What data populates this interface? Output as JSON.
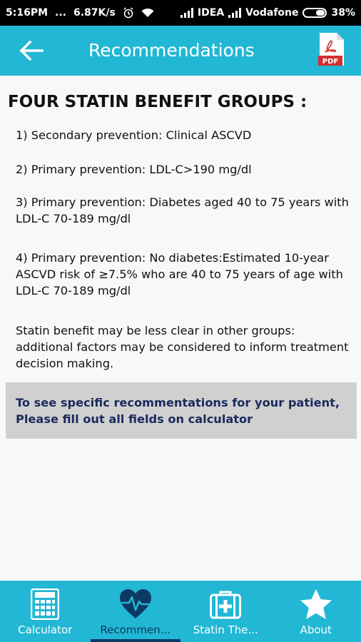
{
  "status_bar": {
    "time": "5:16PM",
    "dots": "...",
    "speed": "6.87K/s",
    "carrier1": "IDEA",
    "carrier2": "Vodafone",
    "battery": "38%"
  },
  "app_bar": {
    "title": "Recommendations",
    "pdf_label": "PDF"
  },
  "content": {
    "heading": "FOUR STATIN BENEFIT GROUPS :",
    "items": [
      "1) Secondary prevention: Clinical ASCVD",
      "2) Primary prevention: LDL-C>190 mg/dl",
      "3) Primary prevention: Diabetes aged 40 to 75 years with LDL-C 70-189 mg/dl",
      "4) Primary prevention: No diabetes:Estimated 10-year ASCVD risk of ≥7.5% who are 40 to 75 years of age with LDL-C 70-189 mg/dl"
    ],
    "note": "Statin benefit may be less clear in other groups: additional factors may be considered to inform treatment decision making.",
    "notice": "To see specific recommentations for your patient, Please fill out all fields on calculator"
  },
  "bottom_nav": {
    "items": [
      {
        "label": "Calculator",
        "icon": "calculator-icon"
      },
      {
        "label": "Recommen...",
        "icon": "heart-pulse-icon"
      },
      {
        "label": "Statin The...",
        "icon": "medical-kit-icon"
      },
      {
        "label": "About",
        "icon": "star-icon"
      }
    ],
    "active_index": 1
  },
  "colors": {
    "accent": "#22b7d4",
    "active_nav": "#0d3a63",
    "notice_bg": "#d0d0d0",
    "notice_text": "#1a2a5c",
    "pdf_red": "#d32f2f"
  }
}
